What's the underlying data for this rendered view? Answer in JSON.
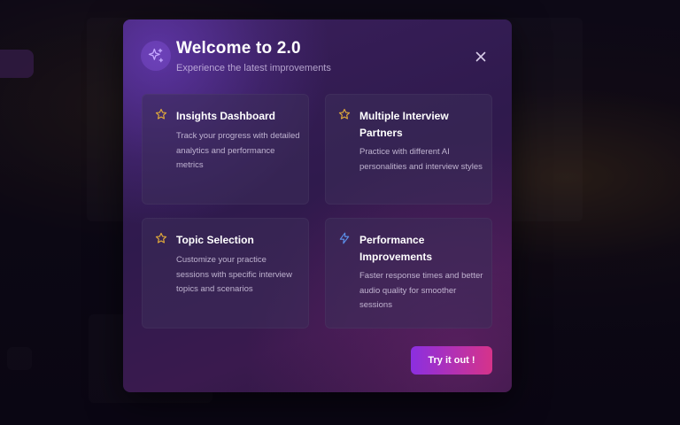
{
  "modal": {
    "title": "Welcome to 2.0",
    "subtitle": "Experience the latest improvements",
    "header_icon": "sparkles-icon",
    "close_icon": "close-icon",
    "cta_label": "Try it out !"
  },
  "features": [
    {
      "icon": "star-icon",
      "title": "Insights Dashboard",
      "description": "Track your progress with detailed analytics and performance metrics"
    },
    {
      "icon": "star-icon",
      "title": "Multiple Interview Partners",
      "description": "Practice with different AI personalities and interview styles"
    },
    {
      "icon": "star-icon",
      "title": "Topic Selection",
      "description": "Customize your practice sessions with specific interview topics and scenarios"
    },
    {
      "icon": "lightning-icon",
      "title": "Performance Improvements",
      "description": "Faster response times and better audio quality for smoother sessions"
    }
  ],
  "colors": {
    "star_icon": "#e0a93a",
    "lightning_icon": "#5b8fe8",
    "sparkle_icon": "#c4a6ff",
    "cta_gradient_start": "#8b2fe0",
    "cta_gradient_end": "#d6338a"
  }
}
